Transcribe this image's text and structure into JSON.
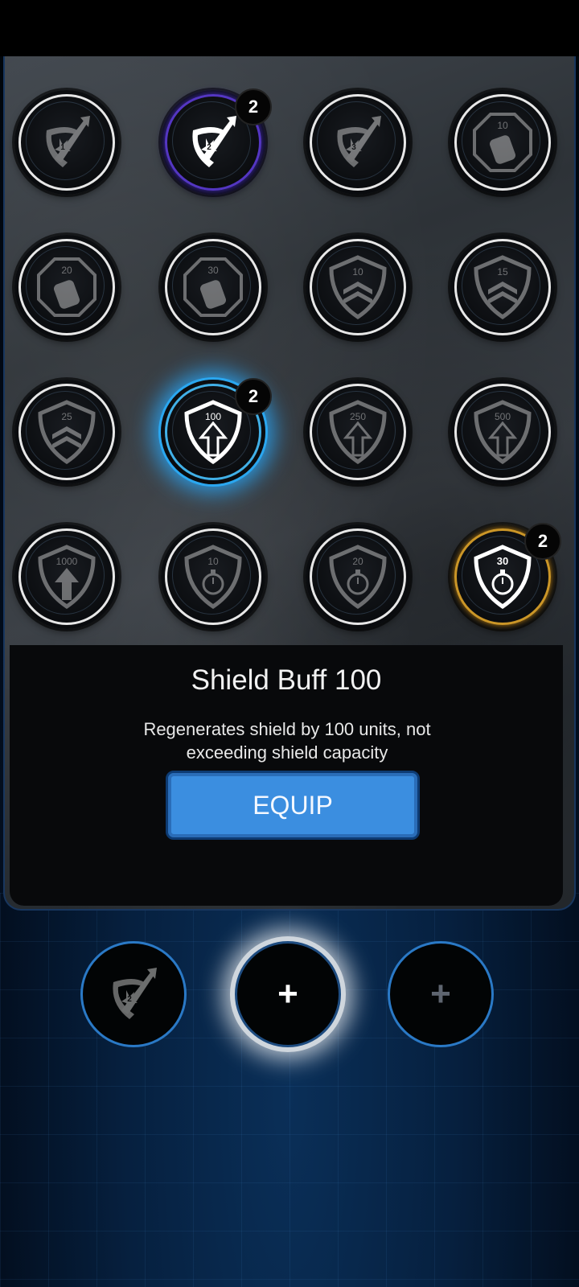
{
  "colors": {
    "selected_glow": "#2aa7f0",
    "equip_button": "#3b8ee0",
    "gold_active": "#e0a52a",
    "purple_active": "#5c3bd6"
  },
  "grid": {
    "r1c1": {
      "icon": "attack-boost-icon",
      "label": "1",
      "tier": "teal"
    },
    "r1c2": {
      "icon": "attack-boost-icon",
      "label": "2",
      "tier": "purple",
      "count": "2"
    },
    "r1c3": {
      "icon": "attack-boost-icon",
      "label": "3",
      "tier": "gold"
    },
    "r1c4": {
      "icon": "ammo-canister-icon",
      "label": "10",
      "tier": "teal"
    },
    "r2c1": {
      "icon": "ammo-canister-icon",
      "label": "20",
      "tier": "blue"
    },
    "r2c2": {
      "icon": "ammo-canister-icon",
      "label": "30",
      "tier": "gold"
    },
    "r2c3": {
      "icon": "rank-shield-icon",
      "label": "10",
      "tier": "teal"
    },
    "r2c4": {
      "icon": "rank-shield-icon",
      "label": "15",
      "tier": "blue"
    },
    "r3c1": {
      "icon": "rank-shield-icon",
      "label": "25",
      "tier": "gold"
    },
    "r3c2": {
      "icon": "shield-buff-icon",
      "label": "100",
      "tier": "teal",
      "count": "2",
      "selected": true
    },
    "r3c3": {
      "icon": "shield-buff-icon",
      "label": "250",
      "tier": "blue"
    },
    "r3c4": {
      "icon": "shield-buff-icon",
      "label": "500",
      "tier": "blue"
    },
    "r4c1": {
      "icon": "shield-buff-icon",
      "label": "1000",
      "tier": "gold"
    },
    "r4c2": {
      "icon": "shield-timer-icon",
      "label": "10",
      "tier": "teal"
    },
    "r4c3": {
      "icon": "shield-timer-icon",
      "label": "20",
      "tier": "blue"
    },
    "r4c4": {
      "icon": "shield-timer-icon",
      "label": "30",
      "tier": "gold",
      "count": "2"
    }
  },
  "details": {
    "title": "Shield Buff 100",
    "description": "Regenerates shield by 100 units, not exceeding shield capacity",
    "equip_label": "EQUIP"
  },
  "equipped": {
    "slot1": {
      "icon": "attack-boost-icon",
      "label": "2"
    },
    "slot2": {
      "symbol": "+"
    },
    "slot3": {
      "symbol": "+"
    }
  }
}
